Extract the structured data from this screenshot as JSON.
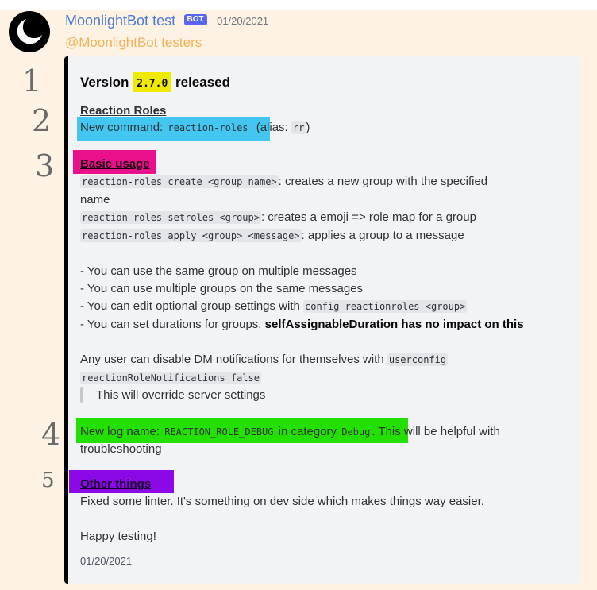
{
  "message": {
    "username": "MoonlightBot test",
    "badge": "BOT",
    "timestamp": "01/20/2021",
    "mention": "@MoonlightBot testers"
  },
  "annotations": [
    "1",
    "2",
    "3",
    "4",
    "5"
  ],
  "embed": {
    "title_prefix": "Version ",
    "version": "2.7.0",
    "title_suffix": " released",
    "section1_heading": "Reaction Roles",
    "new_command_label": "New command: ",
    "new_command_code": "reaction-roles",
    "alias_prefix": " (alias: ",
    "alias_code": "rr",
    "alias_suffix": ")",
    "section2_heading": "Basic usage",
    "usage_create_code": "reaction-roles create <group name>",
    "usage_create_text": ": creates a new group with the specified",
    "usage_create_text2": "name",
    "usage_setroles_code": "reaction-roles setroles <group>",
    "usage_setroles_text": ": creates a emoji => role map for a group",
    "usage_apply_code": "reaction-roles apply <group> <message>",
    "usage_apply_text": ": applies a group to a message",
    "bullet1": "- You can use the same group on multiple messages",
    "bullet2": "- You can use multiple groups on the same messages",
    "bullet3_text": "- You can edit optional group settings with ",
    "bullet3_code": "config reactionroles <group>",
    "bullet4_text": "- You can set durations for groups. ",
    "bullet4_bold": "selfAssignableDuration has no impact on this",
    "dm_text": "Any user can disable DM notifications for themselves with ",
    "dm_code1": "userconfig",
    "dm_code2": "reactionRoleNotifications false",
    "quote_text": "This will override server settings",
    "log_prefix": "New log name: ",
    "log_code": "REACTION_ROLE_DEBUG",
    "log_mid": " in category ",
    "log_code2": "Debug",
    "log_suffix": ". This will be helpful with",
    "log_suffix2": "troubleshooting",
    "section3_heading": "Other things",
    "other_text": "Fixed some linter. It's something on dev side which makes things way easier.",
    "closing": "Happy testing!",
    "footer_date": "01/20/2021"
  },
  "colors": {
    "page_background": "#fdf2e4",
    "embed_background": "#f2f3f5",
    "username": "#4a7bd0",
    "mention": "#f0b256",
    "badge": "#5865f2",
    "highlight_yellow": "#f0ea00",
    "highlight_cyan": "#43c6f0",
    "highlight_magenta": "#ea0f8a",
    "highlight_green": "#23e000",
    "highlight_purple": "#8a09e6"
  }
}
